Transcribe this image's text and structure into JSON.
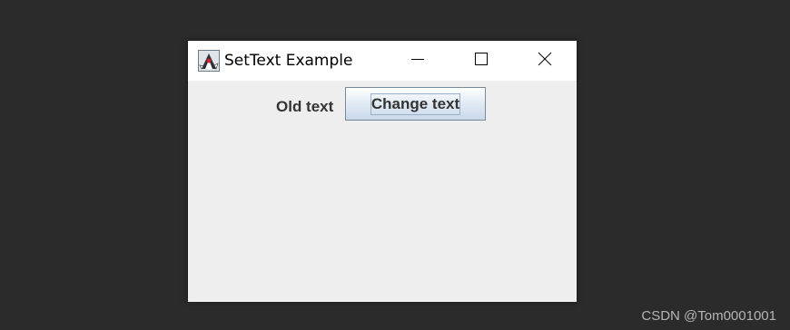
{
  "window": {
    "title": "SetText Example",
    "icon": "java-duke-icon",
    "controls": {
      "minimize": "minimize-icon",
      "maximize": "maximize-icon",
      "close": "close-icon"
    }
  },
  "content": {
    "label_text": "Old text",
    "button_label": "Change text"
  },
  "watermark": "CSDN @Tom0001001",
  "colors": {
    "desktop": "#2b2b2b",
    "titlebar": "#ffffff",
    "window_body": "#eeeeee",
    "text": "#333333"
  }
}
